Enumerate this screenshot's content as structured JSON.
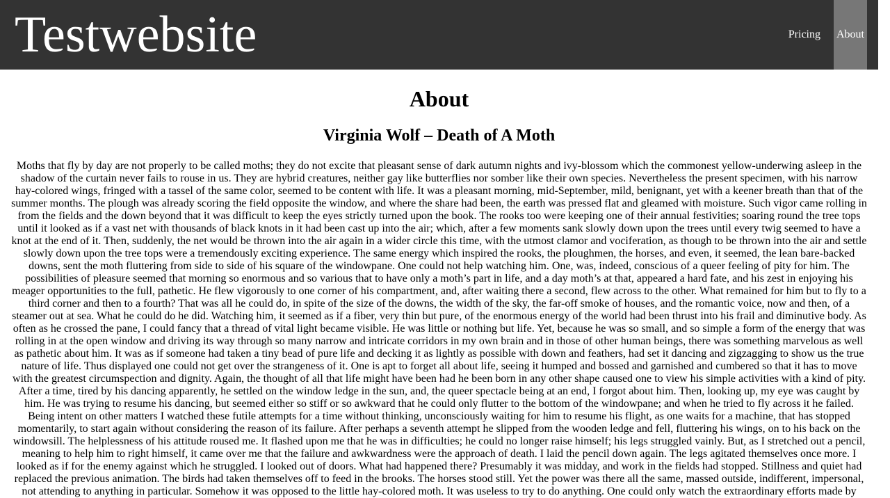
{
  "header": {
    "logo": "Testwebsite",
    "nav": [
      {
        "label": "Pricing",
        "active": false
      },
      {
        "label": "About",
        "active": true
      }
    ],
    "background": "#333333",
    "active_background": "#777777"
  },
  "main": {
    "title": "About",
    "article": {
      "title": "Virginia Wolf – Death of A Moth",
      "body": "Moths that fly by day are not properly to be called moths; they do not excite that pleasant sense of dark autumn nights and ivy-blossom which the commonest yellow-underwing asleep in the shadow of the curtain never fails to rouse in us. They are hybrid creatures, neither gay like butterflies nor somber like their own species. Nevertheless the present specimen, with his narrow hay-colored wings, fringed with a tassel of the same color, seemed to be content with life. It was a pleasant morning, mid-September, mild, benignant, yet with a keener breath than that of the summer months. The plough was already scoring the field opposite the window, and where the share had been, the earth was pressed flat and gleamed with moisture. Such vigor came rolling in from the fields and the down beyond that it was difficult to keep the eyes strictly turned upon the book. The rooks too were keeping one of their annual festivities; soaring round the tree tops until it looked as if a vast net with thousands of black knots in it had been cast up into the air; which, after a few moments sank slowly down upon the trees until every twig seemed to have a knot at the end of it. Then, suddenly, the net would be thrown into the air again in a wider circle this time, with the utmost clamor and vociferation, as though to be thrown into the air and settle slowly down upon the tree tops were a tremendously exciting experience. The same energy which inspired the rooks, the ploughmen, the horses, and even, it seemed, the lean bare-backed downs, sent the moth fluttering from side to side of his square of the windowpane. One could not help watching him. One, was, indeed, conscious of a queer feeling of pity for him. The possibilities of pleasure seemed that morning so enormous and so various that to have only a moth’s part in life, and a day moth’s at that, appeared a hard fate, and his zest in enjoying his meager opportunities to the full, pathetic. He flew vigorously to one corner of his compartment, and, after waiting there a second, flew across to the other. What remained for him but to fly to a third corner and then to a fourth? That was all he could do, in spite of the size of the downs, the width of the sky, the far-off smoke of houses, and the romantic voice, now and then, of a steamer out at sea. What he could do he did. Watching him, it seemed as if a fiber, very thin but pure, of the enormous energy of the world had been thrust into his frail and diminutive body. As often as he crossed the pane, I could fancy that a thread of vital light became visible. He was little or nothing but life. Yet, because he was so small, and so simple a form of the energy that was rolling in at the open window and driving its way through so many narrow and intricate corridors in my own brain and in those of other human beings, there was something marvelous as well as pathetic about him. It was as if someone had taken a tiny bead of pure life and decking it as lightly as possible with down and feathers, had set it dancing and zigzagging to show us the true nature of life. Thus displayed one could not get over the strangeness of it. One is apt to forget all about life, seeing it humped and bossed and garnished and cumbered so that it has to move with the greatest circumspection and dignity. Again, the thought of all that life might have been had he been born in any other shape caused one to view his simple activities with a kind of pity. After a time, tired by his dancing apparently, he settled on the window ledge in the sun, and, the queer spectacle being at an end, I forgot about him. Then, looking up, my eye was caught by him. He was trying to resume his dancing, but seemed either so stiff or so awkward that he could only flutter to the bottom of the windowpane; and when he tried to fly across it he failed. Being intent on other matters I watched these futile attempts for a time without thinking, unconsciously waiting for him to resume his flight, as one waits for a machine, that has stopped momentarily, to start again without considering the reason of its failure. After perhaps a seventh attempt he slipped from the wooden ledge and fell, fluttering his wings, on to his back on the windowsill. The helplessness of his attitude roused me. It flashed upon me that he was in difficulties; he could no longer raise himself; his legs struggled vainly. But, as I stretched out a pencil, meaning to help him to right himself, it came over me that the failure and awkwardness were the approach of death. I laid the pencil down again. The legs agitated themselves once more. I looked as if for the enemy against which he struggled. I looked out of doors. What had happened there? Presumably it was midday, and work in the fields had stopped. Stillness and quiet had replaced the previous animation. The birds had taken themselves off to feed in the brooks. The horses stood still. Yet the power was there all the same, massed outside, indifferent, impersonal, not attending to anything in particular. Somehow it was opposed to the little hay-colored moth. It was useless to try to do anything. One could only watch the extraordinary efforts made by"
    }
  }
}
